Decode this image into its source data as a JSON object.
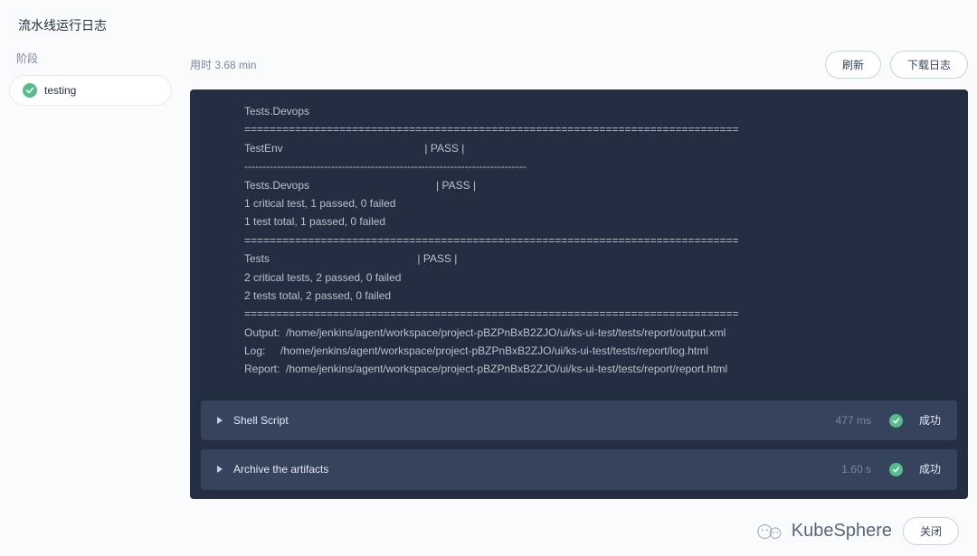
{
  "header": {
    "title": "流水线运行日志"
  },
  "sidebar": {
    "label": "阶段",
    "stages": [
      {
        "name": "testing",
        "status": "success"
      }
    ]
  },
  "topbar": {
    "duration_label": "用时",
    "duration_value": "3.68 min",
    "refresh_label": "刷新",
    "download_label": "下载日志"
  },
  "log_output": {
    "lines": [
      "Tests.Devops",
      "==============================================================================",
      "TestEnv                                               | PASS |",
      "------------------------------------------------------------------------------",
      "Tests.Devops                                          | PASS |",
      "1 critical test, 1 passed, 0 failed",
      "1 test total, 1 passed, 0 failed",
      "==============================================================================",
      "Tests                                                 | PASS |",
      "2 critical tests, 2 passed, 0 failed",
      "2 tests total, 2 passed, 0 failed",
      "==============================================================================",
      "Output:  /home/jenkins/agent/workspace/project-pBZPnBxB2ZJO/ui/ks-ui-test/tests/report/output.xml",
      "Log:     /home/jenkins/agent/workspace/project-pBZPnBxB2ZJO/ui/ks-ui-test/tests/report/log.html",
      "Report:  /home/jenkins/agent/workspace/project-pBZPnBxB2ZJO/ui/ks-ui-test/tests/report/report.html"
    ]
  },
  "steps": [
    {
      "label": "Shell Script",
      "time": "477 ms",
      "status_text": "成功"
    },
    {
      "label": "Archive the artifacts",
      "time": "1.60 s",
      "status_text": "成功"
    }
  ],
  "footer": {
    "brand": "KubeSphere",
    "close_label": "关闭"
  }
}
